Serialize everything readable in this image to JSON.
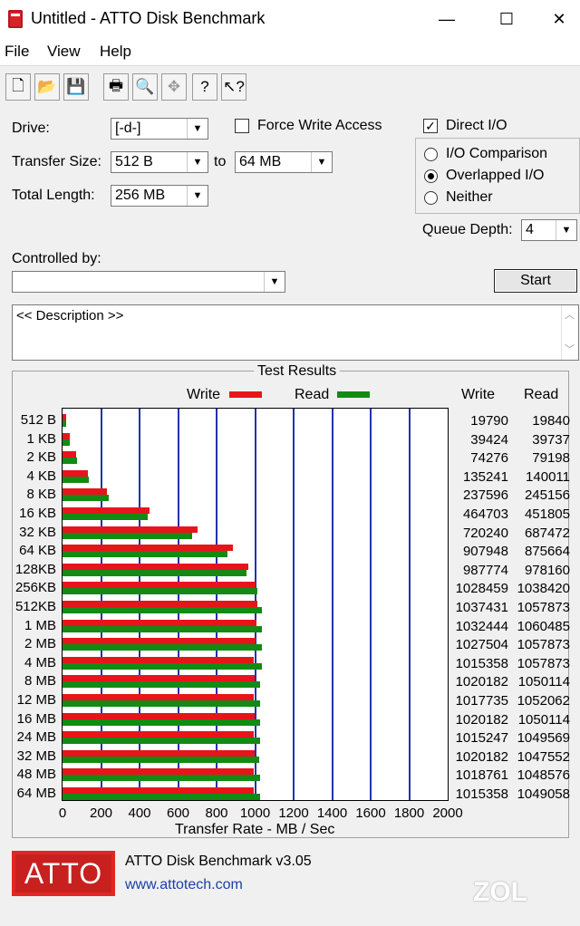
{
  "window": {
    "title": "Untitled - ATTO Disk Benchmark",
    "minimize": "—",
    "maximize": "☐",
    "close": "✕"
  },
  "menu": [
    "File",
    "View",
    "Help"
  ],
  "toolbar": [
    "new-icon",
    "open-icon",
    "save-icon",
    "print-icon",
    "print-preview-icon",
    "move-icon",
    "help-icon",
    "context-help-icon"
  ],
  "form": {
    "drive_label": "Drive:",
    "drive_value": "[-d-]",
    "transfer_size_label": "Transfer Size:",
    "transfer_from": "512 B",
    "to_label": "to",
    "transfer_to": "64 MB",
    "total_length_label": "Total Length:",
    "total_length_value": "256 MB",
    "force_write_label": "Force Write Access",
    "direct_io_label": "Direct I/O",
    "io_comparison_label": "I/O Comparison",
    "overlapped_io_label": "Overlapped I/O",
    "neither_label": "Neither",
    "queue_depth_label": "Queue Depth:",
    "queue_depth_value": "4",
    "controlled_by_label": "Controlled by:",
    "start_label": "Start",
    "description": "<< Description >>"
  },
  "results": {
    "title": "Test Results",
    "legend_write": "Write",
    "legend_read": "Read",
    "col_write": "Write",
    "col_read": "Read",
    "write_color": "#e8141b",
    "read_color": "#138a13"
  },
  "chart_data": {
    "type": "bar",
    "orientation": "horizontal",
    "xlabel": "Transfer Rate - MB / Sec",
    "xlim": [
      0,
      2000
    ],
    "xticks": [
      "0",
      "200",
      "400",
      "600",
      "800",
      "1000",
      "1200",
      "1400",
      "1600",
      "1800",
      "2000"
    ],
    "categories": [
      "512 B",
      "1 KB",
      "2 KB",
      "4 KB",
      "8 KB",
      "16 KB",
      "32 KB",
      "64 KB",
      "128KB",
      "256KB",
      "512KB",
      "1 MB",
      "2 MB",
      "4 MB",
      "8 MB",
      "12 MB",
      "16 MB",
      "24 MB",
      "32 MB",
      "48 MB",
      "64 MB"
    ],
    "series": [
      {
        "name": "Write",
        "values": [
          19790,
          39424,
          74276,
          135241,
          237596,
          464703,
          720240,
          907948,
          987774,
          1028459,
          1037431,
          1032444,
          1027504,
          1015358,
          1020182,
          1017735,
          1020182,
          1015247,
          1020182,
          1018761,
          1015358
        ]
      },
      {
        "name": "Read",
        "values": [
          19840,
          39737,
          79198,
          140011,
          245156,
          451805,
          687472,
          875664,
          978160,
          1038420,
          1057873,
          1060485,
          1057873,
          1057873,
          1050114,
          1052062,
          1050114,
          1049569,
          1047552,
          1048576,
          1049058
        ]
      }
    ]
  },
  "footer": {
    "logo": "ATTO",
    "product": "ATTO Disk Benchmark v3.05",
    "url": "www.attotech.com"
  },
  "watermark": "ZOL"
}
